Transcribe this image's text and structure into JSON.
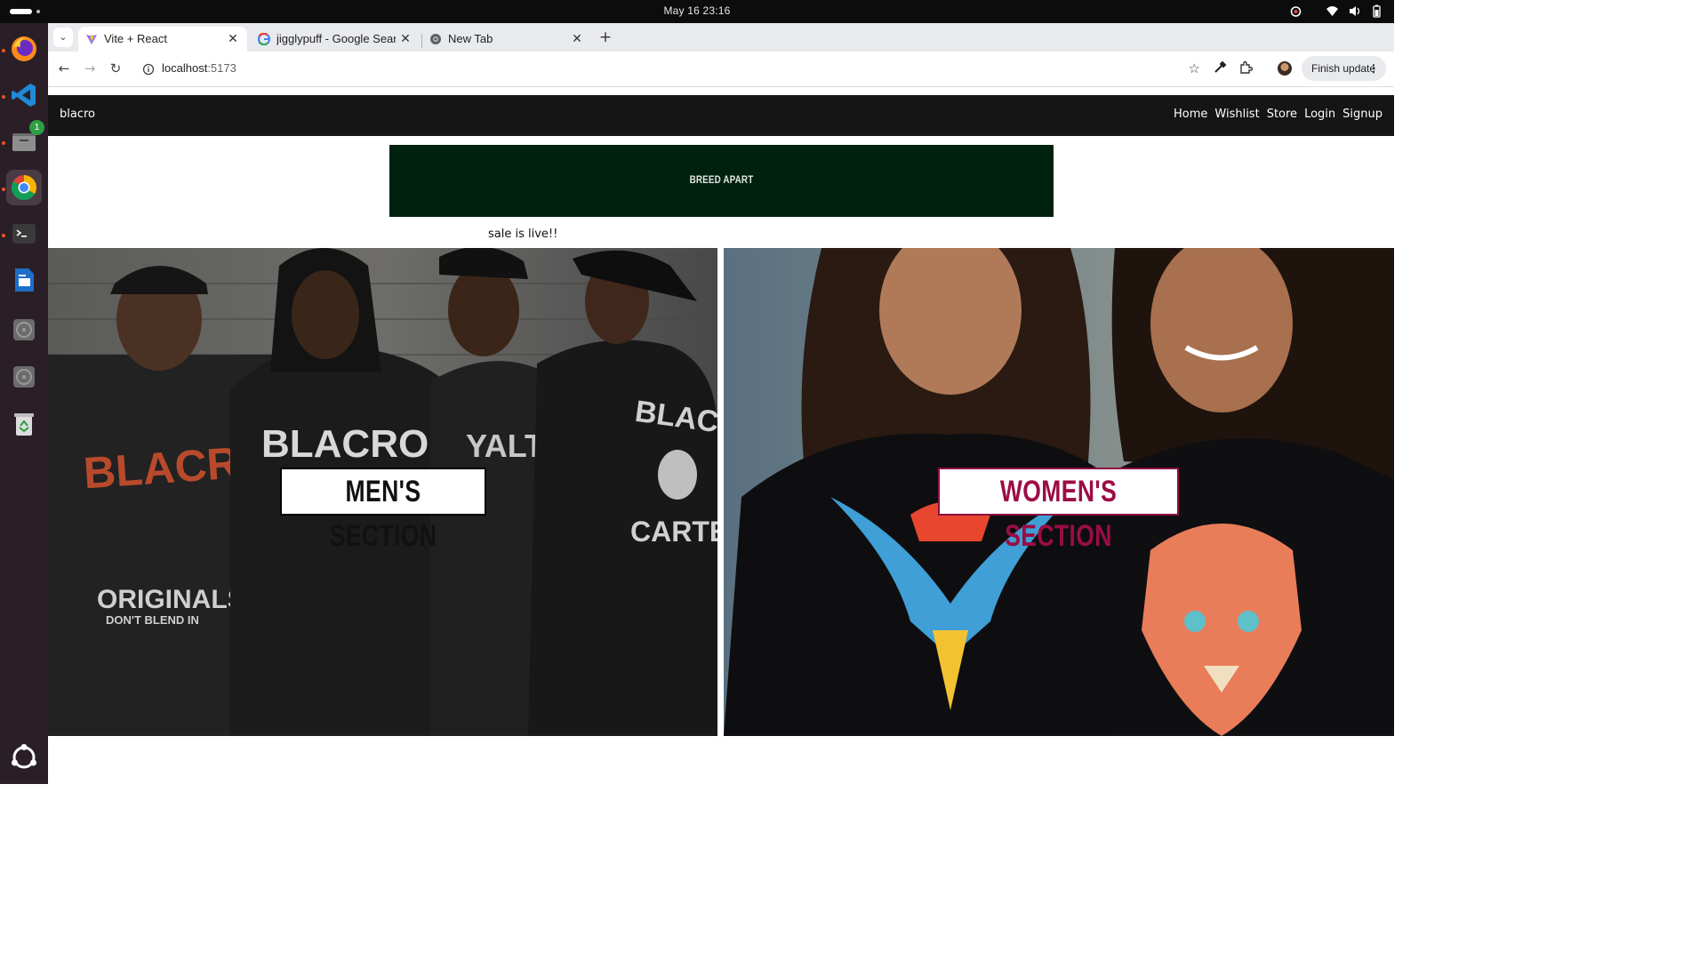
{
  "system": {
    "clock": "May 16  23:16",
    "tray_icons": [
      "alarm-icon",
      "wifi-icon",
      "volume-icon",
      "battery-icon"
    ]
  },
  "dock": {
    "apps": [
      {
        "name": "firefox",
        "icon": "firefox-icon",
        "running": true
      },
      {
        "name": "vscode",
        "icon": "vscode-icon",
        "running": true
      },
      {
        "name": "files",
        "icon": "files-icon",
        "running": true,
        "badge": "1"
      },
      {
        "name": "chrome",
        "icon": "chrome-icon",
        "running": true,
        "active": true
      },
      {
        "name": "terminal",
        "icon": "terminal-icon",
        "running": true
      },
      {
        "name": "writer",
        "icon": "writer-icon",
        "running": false
      },
      {
        "name": "disk1",
        "icon": "disk-icon",
        "running": false
      },
      {
        "name": "disk2",
        "icon": "disk-icon",
        "running": false
      },
      {
        "name": "trash",
        "icon": "trash-icon",
        "running": false
      }
    ]
  },
  "browser": {
    "tabs": [
      {
        "title": "Vite + React",
        "active": true,
        "favicon": "vite-icon"
      },
      {
        "title": "jigglypuff - Google Search",
        "active": false,
        "favicon": "google-icon"
      },
      {
        "title": "New Tab",
        "active": false,
        "favicon": "chrome-icon"
      }
    ],
    "url_host": "localhost",
    "url_port": ":5173",
    "finish_update": "Finish update"
  },
  "site": {
    "brand": "blacro",
    "nav": [
      "Home",
      "Wishlist",
      "Store",
      "Login",
      "Signup"
    ],
    "banner_text": "BREED APART",
    "sale_text": "sale is live!!",
    "men_label": "MEN'S SECTION",
    "women_label": "WOMEN'S SECTION",
    "colors": {
      "navbar": "#151515",
      "banner": "#01210f",
      "women_accent": "#9b0c45"
    }
  }
}
